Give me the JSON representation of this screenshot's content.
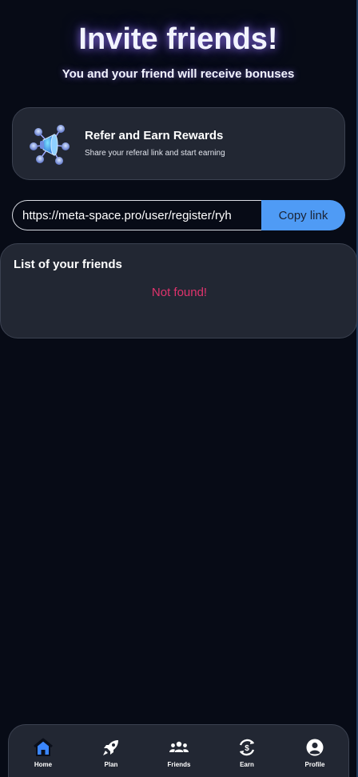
{
  "header": {
    "title": "Invite friends!",
    "subtitle": "You and your friend will receive bonuses"
  },
  "refer_card": {
    "icon": "megaphone-network-icon",
    "title": "Refer and Earn Rewards",
    "description": "Share your referal link and start earning"
  },
  "referral": {
    "link_value": "https://meta-space.pro/user/register/ryh",
    "copy_label": "Copy link"
  },
  "friends": {
    "title": "List of your friends",
    "empty_message": "Not found!"
  },
  "nav": {
    "items": [
      {
        "label": "Home",
        "icon": "home-icon",
        "active": true
      },
      {
        "label": "Plan",
        "icon": "rocket-icon",
        "active": false
      },
      {
        "label": "Friends",
        "icon": "users-icon",
        "active": false
      },
      {
        "label": "Earn",
        "icon": "earn-exchange-icon",
        "active": false
      },
      {
        "label": "Profile",
        "icon": "user-circle-icon",
        "active": false
      }
    ]
  },
  "colors": {
    "background": "#070b16",
    "card": "#222733",
    "accent": "#4f9bf5",
    "error": "#e0336d",
    "active_nav": "#3a86ff"
  }
}
